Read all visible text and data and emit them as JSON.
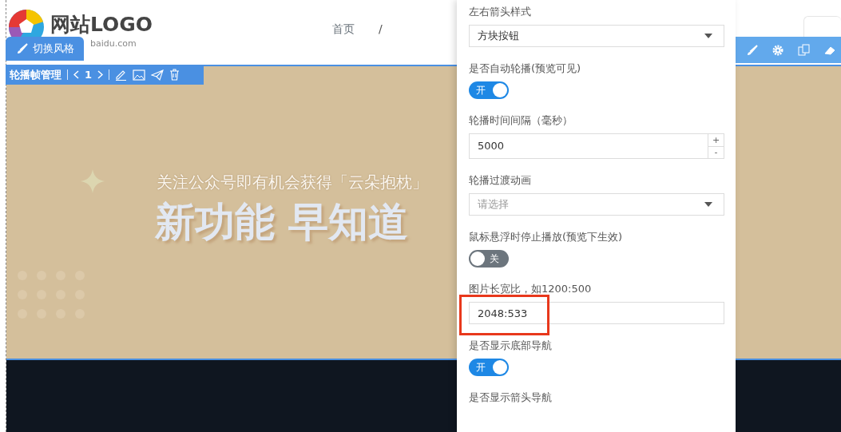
{
  "header": {
    "logo_text": "网站LOGO",
    "logo_subtext": "baidu.com",
    "nav": [
      {
        "label": "首页"
      }
    ],
    "nav_separator": "/"
  },
  "style_tab": {
    "label": "切换风格"
  },
  "carousel_toolbar": {
    "title": "轮播帧管理",
    "frame": "1"
  },
  "banner": {
    "subtitle": "关注公众号即有机会获得「云朵抱枕」",
    "headline": "新功能 早知道"
  },
  "settings_panel": {
    "fields": [
      {
        "kind": "select",
        "label": "左右箭头样式",
        "value": "方块按钮"
      },
      {
        "kind": "toggle",
        "label": "是否自动轮播(预览可见)",
        "on": true,
        "text": "开"
      },
      {
        "kind": "number",
        "label": "轮播时间间隔（毫秒）",
        "value": "5000",
        "increment": "+",
        "decrement": "-"
      },
      {
        "kind": "select",
        "label": "轮播过渡动画",
        "placeholder": "请选择"
      },
      {
        "kind": "toggle",
        "label": "鼠标悬浮时停止播放(预览下生效)",
        "on": false,
        "text": "关"
      },
      {
        "kind": "text",
        "label": "图片长宽比，如1200:500",
        "value": "2048:533",
        "highlighted": true
      },
      {
        "kind": "toggle",
        "label": "是否显示底部导航",
        "on": true,
        "text": "开"
      },
      {
        "kind": "label",
        "label": "是否显示箭头导航"
      }
    ]
  }
}
